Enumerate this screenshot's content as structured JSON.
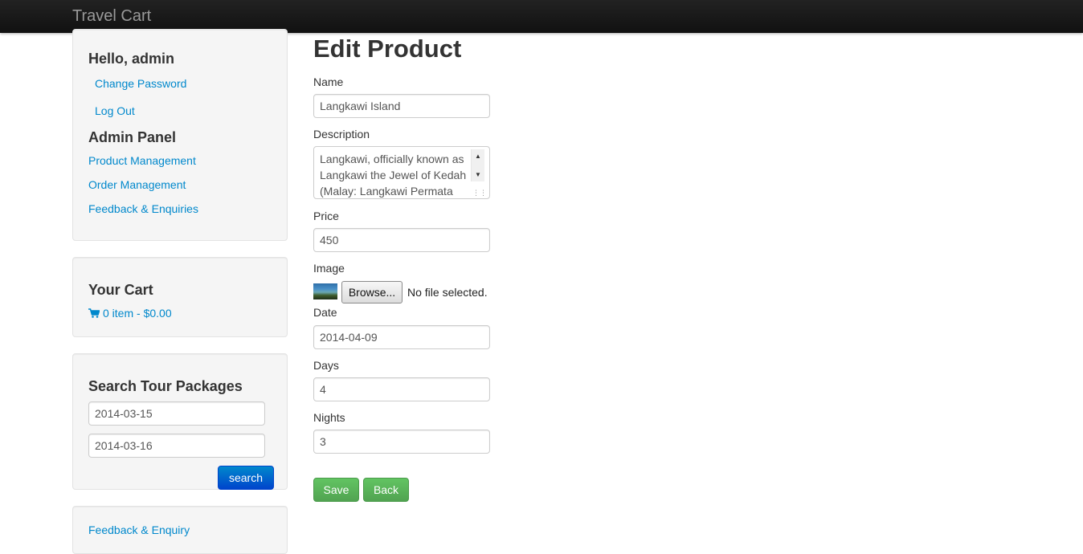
{
  "navbar": {
    "brand": "Travel Cart"
  },
  "sidebar": {
    "greeting": "Hello, admin",
    "change_password": "Change Password",
    "logout": "Log Out",
    "admin_heading": "Admin Panel",
    "admin_links": [
      "Product Management",
      "Order Management",
      "Feedback & Enquiries"
    ],
    "cart_heading": "Your Cart",
    "cart_summary": "0 item - $0.00",
    "search_heading": "Search Tour Packages",
    "search_from": "2014-03-15",
    "search_to": "2014-03-16",
    "search_button": "search",
    "feedback_link": "Feedback & Enquiry"
  },
  "form": {
    "title": "Edit Product",
    "name_label": "Name",
    "name_value": "Langkawi Island",
    "description_label": "Description",
    "description_value": "Langkawi, officially known as Langkawi the Jewel of Kedah (Malay: Langkawi Permata",
    "price_label": "Price",
    "price_value": "450",
    "image_label": "Image",
    "browse_button": "Browse...",
    "file_status": "No file selected.",
    "date_label": "Date",
    "date_value": "2014-04-09",
    "days_label": "Days",
    "days_value": "4",
    "nights_label": "Nights",
    "nights_value": "3",
    "save_button": "Save",
    "back_button": "Back"
  },
  "colors": {
    "link": "#0088cc",
    "navbar": "#1b1b1b",
    "primary_button": "#0055cc",
    "success_button": "#5bb75b"
  },
  "icons": {
    "cart": "shopping-cart-icon"
  }
}
